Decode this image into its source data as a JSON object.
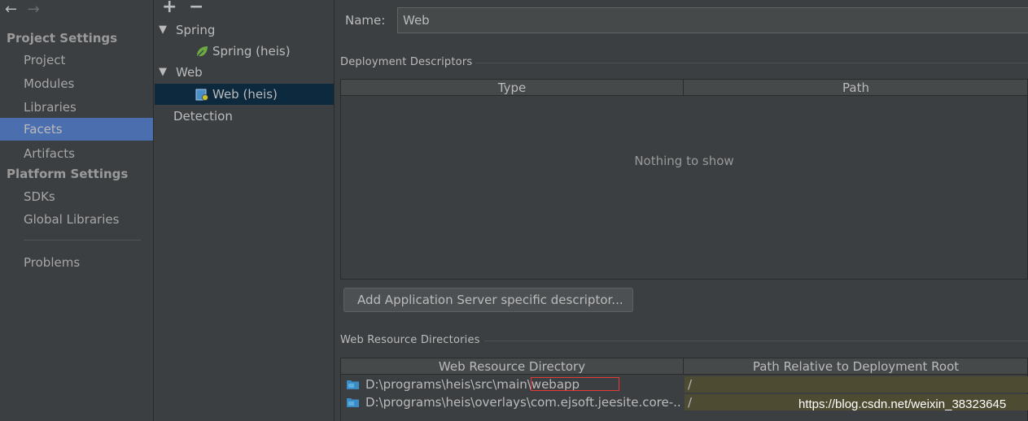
{
  "nav": {
    "project_settings": "Project Settings",
    "items_project": [
      "Project",
      "Modules",
      "Libraries",
      "Facets",
      "Artifacts"
    ],
    "platform_settings": "Platform Settings",
    "items_platform": [
      "SDKs",
      "Global Libraries"
    ],
    "problems": "Problems",
    "selected": "Facets"
  },
  "toolbar": {
    "add": "+",
    "remove": "−"
  },
  "tree": {
    "spring": "Spring",
    "spring_child": "Spring (heis)",
    "web": "Web",
    "web_child": "Web (heis)",
    "detection": "Detection"
  },
  "main": {
    "name_label": "Name:",
    "name_value": "Web",
    "deployment_title": "Deployment Descriptors",
    "deployment_cols": [
      "Type",
      "Path"
    ],
    "empty_text": "Nothing to show",
    "add_button": "Add Application Server specific descriptor...",
    "web_resource_title": "Web Resource Directories",
    "web_resource_cols": [
      "Web Resource Directory",
      "Path Relative to Deployment Root"
    ],
    "web_rows": [
      {
        "dir": "D:\\programs\\heis\\src\\main\\webapp",
        "rel": "/"
      },
      {
        "dir": "D:\\programs\\heis\\overlays\\com.ejsoft.jeesite.core-...",
        "rel": "/"
      }
    ]
  },
  "watermark": "https://blog.csdn.net/weixin_38323645",
  "colors": {
    "selection": "#4b6eaf",
    "tree_selection": "#0d293e",
    "path_cell": "#4e4b33",
    "highlight": "#e53935"
  }
}
